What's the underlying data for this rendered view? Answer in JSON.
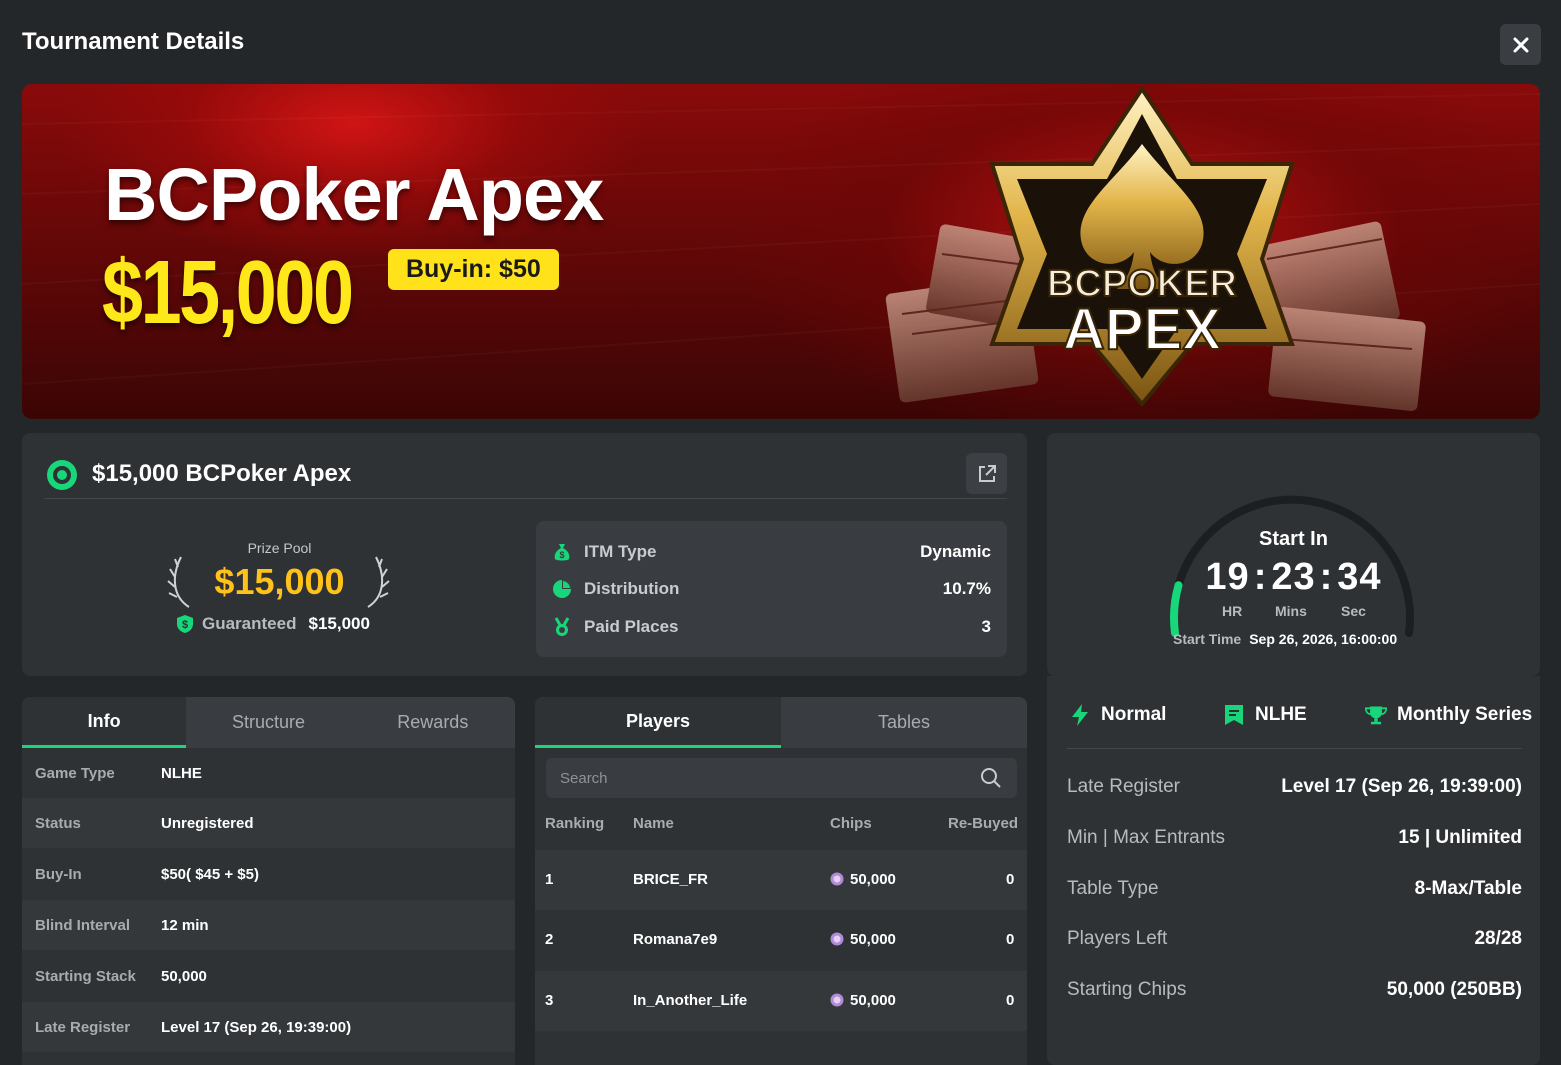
{
  "header": {
    "title": "Tournament Details",
    "close_icon": "×"
  },
  "banner": {
    "brand": "BCPoker Apex",
    "amount": "$15,000",
    "buyin": "Buy-in: $50",
    "emblem_line1": "BCPOKER",
    "emblem_line2": "APEX"
  },
  "tournament": {
    "name": "$15,000 BCPoker Apex",
    "prize_pool_label": "Prize Pool",
    "prize_pool_value": "$15,000",
    "guaranteed_label": "Guaranteed",
    "guaranteed_value": "$15,000",
    "itm": [
      {
        "label": "ITM Type",
        "value": "Dynamic",
        "icon": "money-bag-icon"
      },
      {
        "label": "Distribution",
        "value": "10.7%",
        "icon": "pie-chart-icon"
      },
      {
        "label": "Paid Places",
        "value": "3",
        "icon": "medal-icon"
      }
    ]
  },
  "timer": {
    "label": "Start In",
    "hours": "19",
    "mins": "23",
    "secs": "34",
    "hr_label": "HR",
    "mins_label": "Mins",
    "sec_label": "Sec",
    "start_time_label": "Start Time",
    "start_time_value": "Sep 26, 2026, 16:00:00",
    "progress_fraction": 0.12
  },
  "info_tabs": [
    "Info",
    "Structure",
    "Rewards"
  ],
  "info_rows": [
    {
      "label": "Game Type",
      "value": "NLHE"
    },
    {
      "label": "Status",
      "value": "Unregistered"
    },
    {
      "label": "Buy-In",
      "value": "$50( $45 + $5)"
    },
    {
      "label": "Blind Interval",
      "value": "12 min"
    },
    {
      "label": "Starting Stack",
      "value": "50,000"
    },
    {
      "label": "Late Register",
      "value": "Level 17 (Sep 26, 19:39:00)"
    }
  ],
  "players_tabs": [
    "Players",
    "Tables"
  ],
  "search": {
    "placeholder": "Search"
  },
  "players_headers": [
    "Ranking",
    "Name",
    "Chips",
    "Re-Buyed"
  ],
  "players": [
    {
      "rank": "1",
      "name": "BRICE_FR",
      "chips": "50,000",
      "rebuy": "0"
    },
    {
      "rank": "2",
      "name": "Romana7e9",
      "chips": "50,000",
      "rebuy": "0"
    },
    {
      "rank": "3",
      "name": "In_Another_Life",
      "chips": "50,000",
      "rebuy": "0"
    }
  ],
  "tags": [
    {
      "label": "Normal",
      "icon": "lightning-icon"
    },
    {
      "label": "NLHE",
      "icon": "bookmark-icon"
    },
    {
      "label": "Monthly Series",
      "icon": "trophy-icon"
    }
  ],
  "details": [
    {
      "label": "Late Register",
      "value": "Level 17 (Sep 26, 19:39:00)"
    },
    {
      "label": "Min | Max Entrants",
      "value": "15 | Unlimited"
    },
    {
      "label": "Table Type",
      "value": "8-Max/Table"
    },
    {
      "label": "Players Left",
      "value": "28/28"
    },
    {
      "label": "Starting Chips",
      "value": "50,000 (250BB)"
    }
  ],
  "colors": {
    "accent": "#18d67a",
    "gold": "#ffc21a",
    "banner_yellow": "#ffe81a",
    "panel": "#2e3235"
  }
}
